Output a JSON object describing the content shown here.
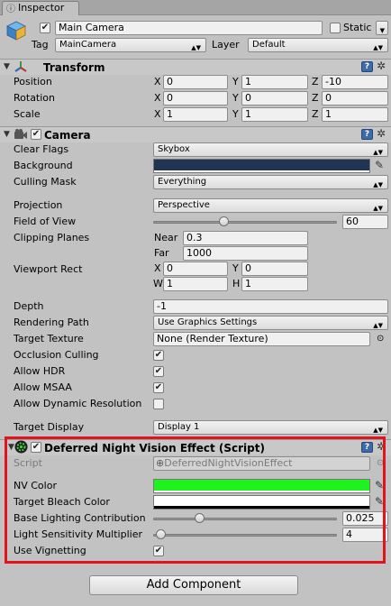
{
  "tab": {
    "title": "Inspector"
  },
  "header": {
    "enabled": true,
    "name": "Main Camera",
    "static_label": "Static",
    "tag_label": "Tag",
    "tag_value": "MainCamera",
    "layer_label": "Layer",
    "layer_value": "Default"
  },
  "transform": {
    "title": "Transform",
    "position": {
      "label": "Position",
      "x": "0",
      "y": "1",
      "z": "-10"
    },
    "rotation": {
      "label": "Rotation",
      "x": "0",
      "y": "0",
      "z": "0"
    },
    "scale": {
      "label": "Scale",
      "x": "1",
      "y": "1",
      "z": "1"
    }
  },
  "axes": {
    "x": "X",
    "y": "Y",
    "z": "Z",
    "w": "W",
    "h": "H"
  },
  "camera": {
    "title": "Camera",
    "clear_flags": {
      "label": "Clear Flags",
      "value": "Skybox"
    },
    "background": {
      "label": "Background",
      "color": "#1f3553"
    },
    "culling_mask": {
      "label": "Culling Mask",
      "value": "Everything"
    },
    "projection": {
      "label": "Projection",
      "value": "Perspective"
    },
    "fov": {
      "label": "Field of View",
      "value": "60",
      "fraction": 0.38
    },
    "clipping": {
      "label": "Clipping Planes",
      "near_label": "Near",
      "near": "0.3",
      "far_label": "Far",
      "far": "1000"
    },
    "viewport": {
      "label": "Viewport Rect",
      "x": "0",
      "y": "0",
      "w": "1",
      "h": "1"
    },
    "depth": {
      "label": "Depth",
      "value": "-1"
    },
    "rendering_path": {
      "label": "Rendering Path",
      "value": "Use Graphics Settings"
    },
    "target_texture": {
      "label": "Target Texture",
      "value": "None (Render Texture)"
    },
    "occlusion": {
      "label": "Occlusion Culling",
      "checked": true
    },
    "hdr": {
      "label": "Allow HDR",
      "checked": true
    },
    "msaa": {
      "label": "Allow MSAA",
      "checked": true
    },
    "dynres": {
      "label": "Allow Dynamic Resolution",
      "checked": false
    },
    "target_display": {
      "label": "Target Display",
      "value": "Display 1"
    }
  },
  "script_comp": {
    "title": "Deferred Night Vision Effect (Script)",
    "script": {
      "label": "Script",
      "value": "DeferredNightVisionEffect"
    },
    "nv_color": {
      "label": "NV Color",
      "color": "#1ef31e"
    },
    "bleach": {
      "label": "Target Bleach Color",
      "color": "#ffffff"
    },
    "base_light": {
      "label": "Base Lighting Contribution",
      "value": "0.025",
      "fraction": 0.25
    },
    "sensitivity": {
      "label": "Light Sensitivity Multiplier",
      "value": "4",
      "fraction": 0.04
    },
    "vignetting": {
      "label": "Use Vignetting",
      "checked": true
    }
  },
  "add_component": "Add Component"
}
